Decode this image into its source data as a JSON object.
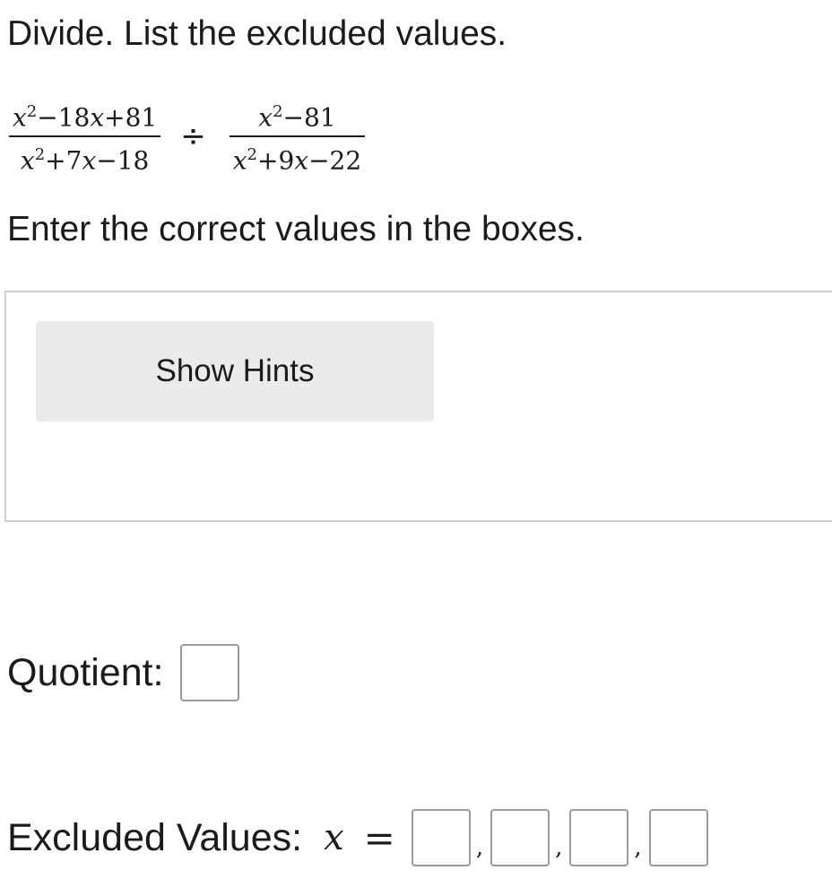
{
  "instruction": "Divide. List the excluded values.",
  "problem": {
    "fraction1": {
      "numerator": [
        "x",
        "2",
        "−18",
        "x",
        "+81"
      ],
      "denominator": [
        "x",
        "2",
        "+7",
        "x",
        "−18"
      ]
    },
    "operator": "÷",
    "fraction2": {
      "numerator": [
        "x",
        "2",
        "−81"
      ],
      "denominator": [
        "x",
        "2",
        "+9",
        "x",
        "−22"
      ]
    }
  },
  "enter_prompt": "Enter the correct values in the boxes.",
  "hints": {
    "button_label": "Show Hints"
  },
  "quotient": {
    "label": "Quotient:",
    "value": ""
  },
  "excluded": {
    "label": "Excluded Values:",
    "variable": "x",
    "equals": "=",
    "separator": ",",
    "values": [
      "",
      "",
      "",
      ""
    ]
  }
}
